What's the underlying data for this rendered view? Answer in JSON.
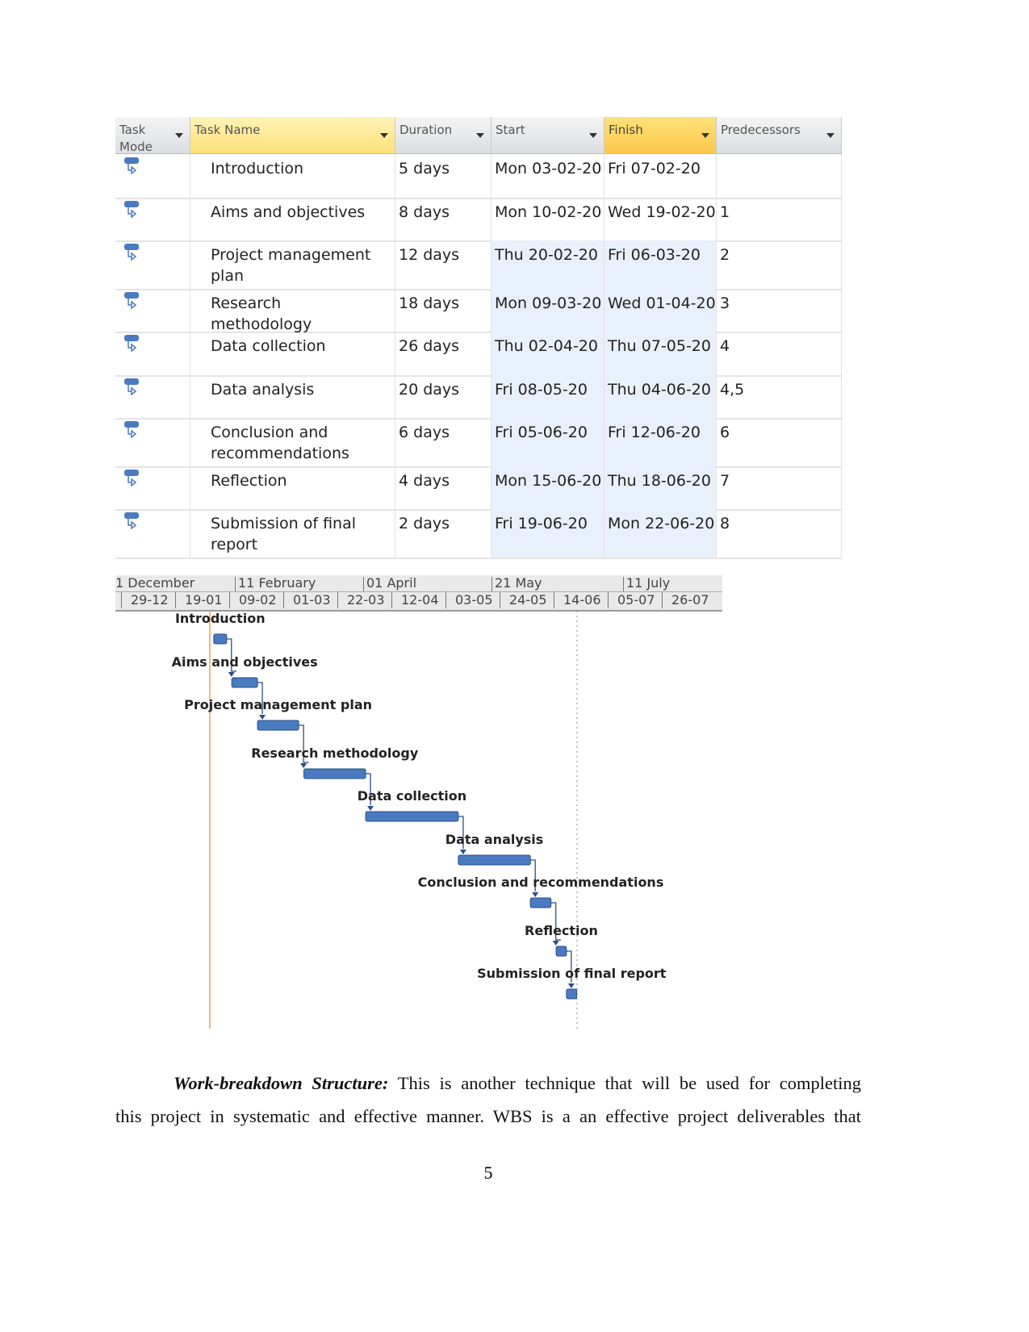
{
  "table": {
    "headers": [
      "Task Mode",
      "Task Name",
      "Duration",
      "Start",
      "Finish",
      "Predecessors"
    ],
    "rows": [
      {
        "name": "Introduction",
        "duration": "5 days",
        "start": "Mon 03-02-20",
        "finish": "Fri 07-02-20",
        "pred": ""
      },
      {
        "name": "Aims and objectives",
        "duration": "8 days",
        "start": "Mon 10-02-20",
        "finish": "Wed 19-02-20",
        "pred": "1"
      },
      {
        "name": "Project management plan",
        "duration": "12 days",
        "start": "Thu 20-02-20",
        "finish": "Fri 06-03-20",
        "pred": "2"
      },
      {
        "name": "Research methodology",
        "duration": "18 days",
        "start": "Mon 09-03-20",
        "finish": "Wed 01-04-20",
        "pred": "3"
      },
      {
        "name": "Data collection",
        "duration": "26 days",
        "start": "Thu 02-04-20",
        "finish": "Thu 07-05-20",
        "pred": "4"
      },
      {
        "name": "Data analysis",
        "duration": "20 days",
        "start": "Fri 08-05-20",
        "finish": "Thu 04-06-20",
        "pred": "4,5"
      },
      {
        "name": "Conclusion and recommendations",
        "duration": "6 days",
        "start": "Fri 05-06-20",
        "finish": "Fri 12-06-20",
        "pred": "6"
      },
      {
        "name": "Reflection",
        "duration": "4 days",
        "start": "Mon 15-06-20",
        "finish": "Thu 18-06-20",
        "pred": "7"
      },
      {
        "name": "Submission of final report",
        "duration": "2 days",
        "start": "Fri 19-06-20",
        "finish": "Mon 22-06-20",
        "pred": "8"
      }
    ],
    "task_mode_icon": "auto-scheduled-task-icon"
  },
  "timeline": {
    "top_tier": [
      "1 December",
      "11 February",
      "01 April",
      "21 May",
      "11 July"
    ],
    "bottom_tier": [
      "29-12",
      "19-01",
      "09-02",
      "01-03",
      "22-03",
      "12-04",
      "03-05",
      "24-05",
      "14-06",
      "05-07",
      "26-07"
    ]
  },
  "colors": {
    "bar": "#4a7ac0",
    "header_selected": "#ffe17a",
    "today_line": "#e8a060"
  },
  "paragraph": {
    "bold": "Work-breakdown Structure:",
    "line1": " This is another technique that will be used for completing",
    "line2": "this project in systematic and effective manner. WBS is a an effective project deliverables that"
  },
  "page_number": "5"
}
